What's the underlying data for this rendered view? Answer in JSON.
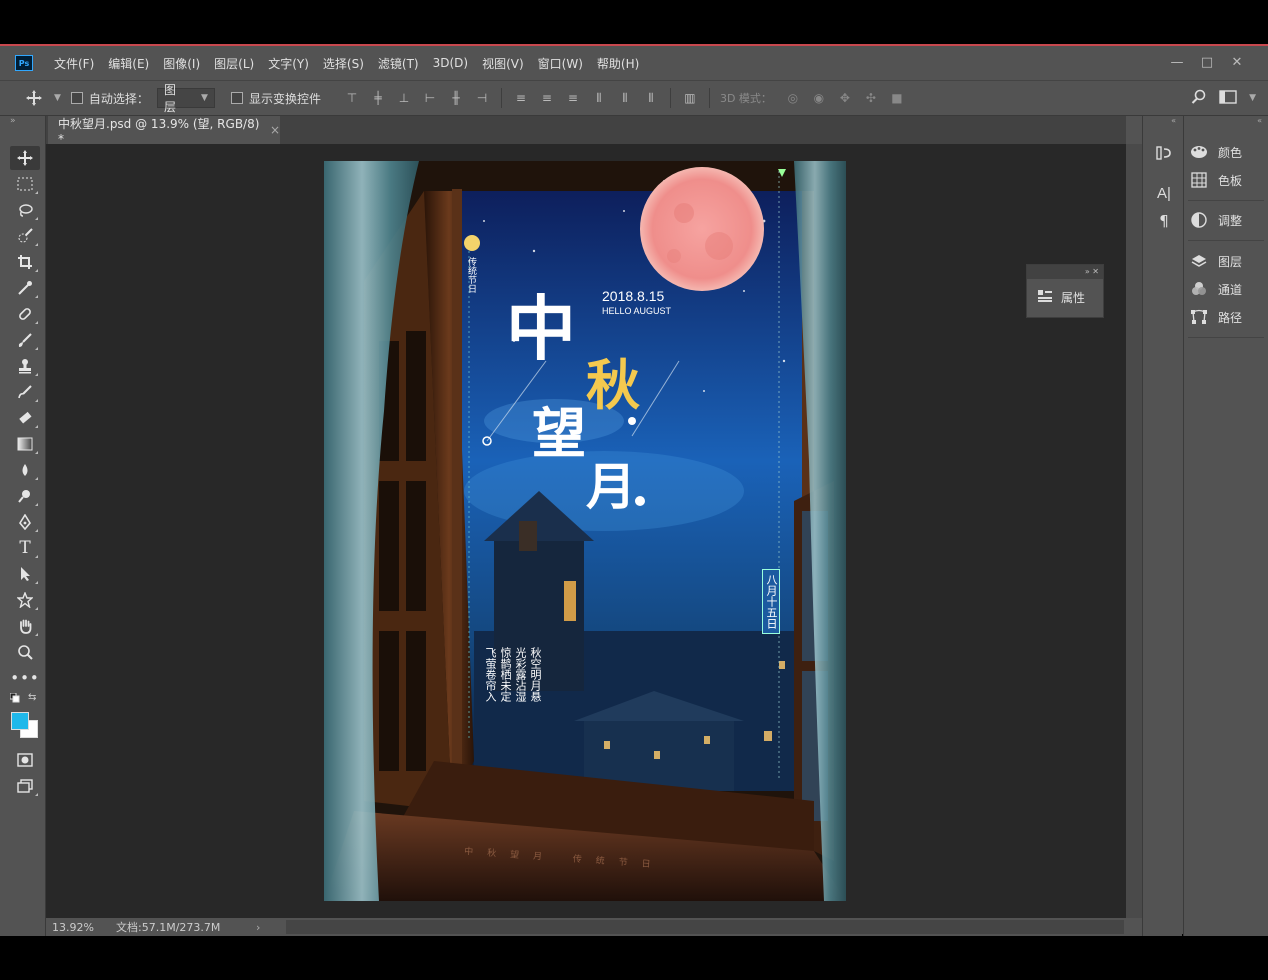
{
  "app": {
    "logo": "Ps"
  },
  "menu": [
    "文件(F)",
    "编辑(E)",
    "图像(I)",
    "图层(L)",
    "文字(Y)",
    "选择(S)",
    "滤镜(T)",
    "3D(D)",
    "视图(V)",
    "窗口(W)",
    "帮助(H)"
  ],
  "window_controls": [
    "—",
    "□",
    "✕"
  ],
  "options": {
    "auto_select_label": "自动选择：",
    "auto_select_value": "图层",
    "show_transform_label": "显示变换控件",
    "mode_3d_label": "3D 模式："
  },
  "document": {
    "tab_title": "中秋望月.psd @ 13.9% (望, RGB/8) *",
    "close": "×"
  },
  "status": {
    "zoom": "13.92%",
    "doc_info": "文档:57.1M/273.7M",
    "arrow": "›"
  },
  "panels": {
    "dock": [
      {
        "label": "颜色",
        "icon": "palette-icon"
      },
      {
        "label": "色板",
        "icon": "grid-icon"
      },
      {
        "label": "调整",
        "icon": "adjust-icon"
      },
      {
        "label": "图层",
        "icon": "layers-icon"
      },
      {
        "label": "通道",
        "icon": "channels-icon"
      },
      {
        "label": "路径",
        "icon": "paths-icon"
      }
    ],
    "floating": {
      "label": "属性"
    }
  },
  "colors": {
    "foreground": "#1fb8ea",
    "background": "#ffffff",
    "accent": "#31a8ff"
  },
  "poster": {
    "title_chars": [
      "中",
      "秋",
      "望",
      "月"
    ],
    "date": "2018.8.15",
    "subtitle": "HELLO AUGUST",
    "left_vertical": "传统节日",
    "date_vertical": "八月十五日",
    "poem_cols": [
      "秋空明月悬",
      "光彩露沾湿",
      "惊鹊栖未定",
      "飞萤卷帘入"
    ],
    "bottom_text": "中秋望月 传统节日"
  }
}
